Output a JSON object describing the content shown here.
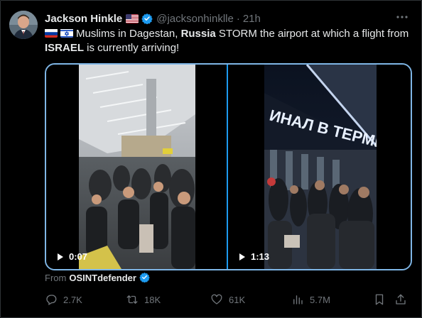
{
  "tweet": {
    "author_name": "Jackson Hinkle",
    "handle": "@jacksonhinklle",
    "separator": "·",
    "time": "21h",
    "text_parts": {
      "p1": "Muslims in Dagestan, ",
      "p2": "Russia",
      "p3": " STORM the airport at which a flight from ",
      "p4": "ISRAEL",
      "p5": " is currently arriving!"
    },
    "videos": [
      {
        "duration": "0:07"
      },
      {
        "duration": "1:13"
      }
    ],
    "from_label": "From",
    "from_account": "OSINTdefender"
  },
  "actions": {
    "replies": "2.7K",
    "retweets": "18K",
    "likes": "61K",
    "views": "5.7M"
  },
  "icons": {
    "more": "more-icon",
    "verified": "verified-badge-icon",
    "reply": "reply-icon",
    "retweet": "retweet-icon",
    "like": "heart-icon",
    "views": "views-chart-icon",
    "bookmark": "bookmark-icon",
    "share": "share-icon"
  },
  "colors": {
    "background": "#000000",
    "text": "#e7e9ea",
    "muted": "#71767b",
    "accent": "#1d9bf0"
  }
}
